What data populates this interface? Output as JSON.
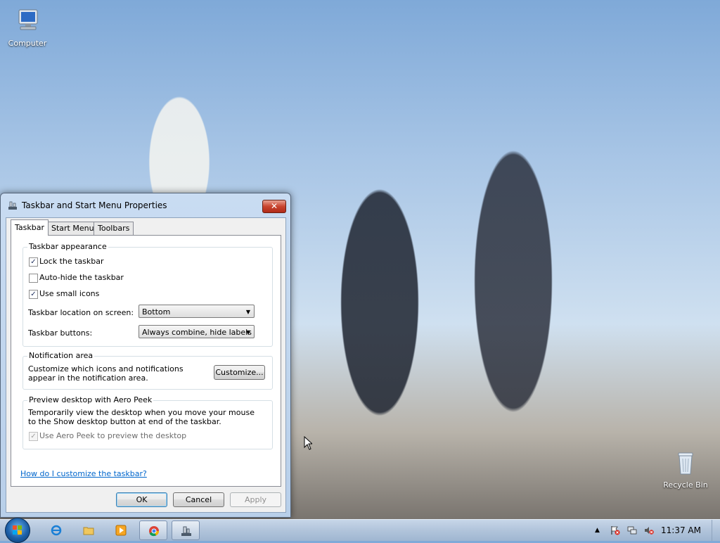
{
  "desktop": {
    "icons": [
      {
        "label": "Computer"
      },
      {
        "label": "Recycle Bin"
      }
    ]
  },
  "dialog": {
    "title": "Taskbar and Start Menu Properties",
    "close_glyph": "✕",
    "tabs": [
      {
        "label": "Taskbar",
        "active": true
      },
      {
        "label": "Start Menu",
        "active": false
      },
      {
        "label": "Toolbars",
        "active": false
      }
    ],
    "appearance": {
      "legend": "Taskbar appearance",
      "lock_label": "Lock the taskbar",
      "lock_checked": true,
      "autohide_label": "Auto-hide the taskbar",
      "autohide_checked": false,
      "small_icons_label": "Use small icons",
      "small_icons_checked": true,
      "location_label": "Taskbar location on screen:",
      "location_value": "Bottom",
      "buttons_label": "Taskbar buttons:",
      "buttons_value": "Always combine, hide labels"
    },
    "notification": {
      "legend": "Notification area",
      "description": "Customize which icons and notifications appear in the notification area.",
      "customize_button": "Customize..."
    },
    "aero_peek": {
      "legend": "Preview desktop with Aero Peek",
      "description": "Temporarily view the desktop when you move your mouse to the Show desktop button at end of the taskbar.",
      "checkbox_label": "Use Aero Peek to preview the desktop",
      "checked": true,
      "disabled": true
    },
    "help_link": "How do I customize the taskbar?",
    "buttons": {
      "ok": "OK",
      "cancel": "Cancel",
      "apply": "Apply"
    }
  },
  "taskbar": {
    "clock": "11:37 AM",
    "pinned": [
      {
        "icon": "internet-explorer-icon"
      },
      {
        "icon": "windows-explorer-icon"
      },
      {
        "icon": "media-player-icon"
      },
      {
        "icon": "chrome-icon"
      },
      {
        "icon": "taskbar-properties-icon"
      }
    ],
    "tray": [
      {
        "icon": "show-hidden-icons-chevron"
      },
      {
        "icon": "action-center-flag-icon"
      },
      {
        "icon": "network-icon"
      },
      {
        "icon": "volume-muted-icon"
      }
    ]
  },
  "colors": {
    "accent": "#0066cc",
    "dialog_frame": "#c9dcf2",
    "taskbar": "#b1c4db",
    "close_button": "#c9452f"
  }
}
